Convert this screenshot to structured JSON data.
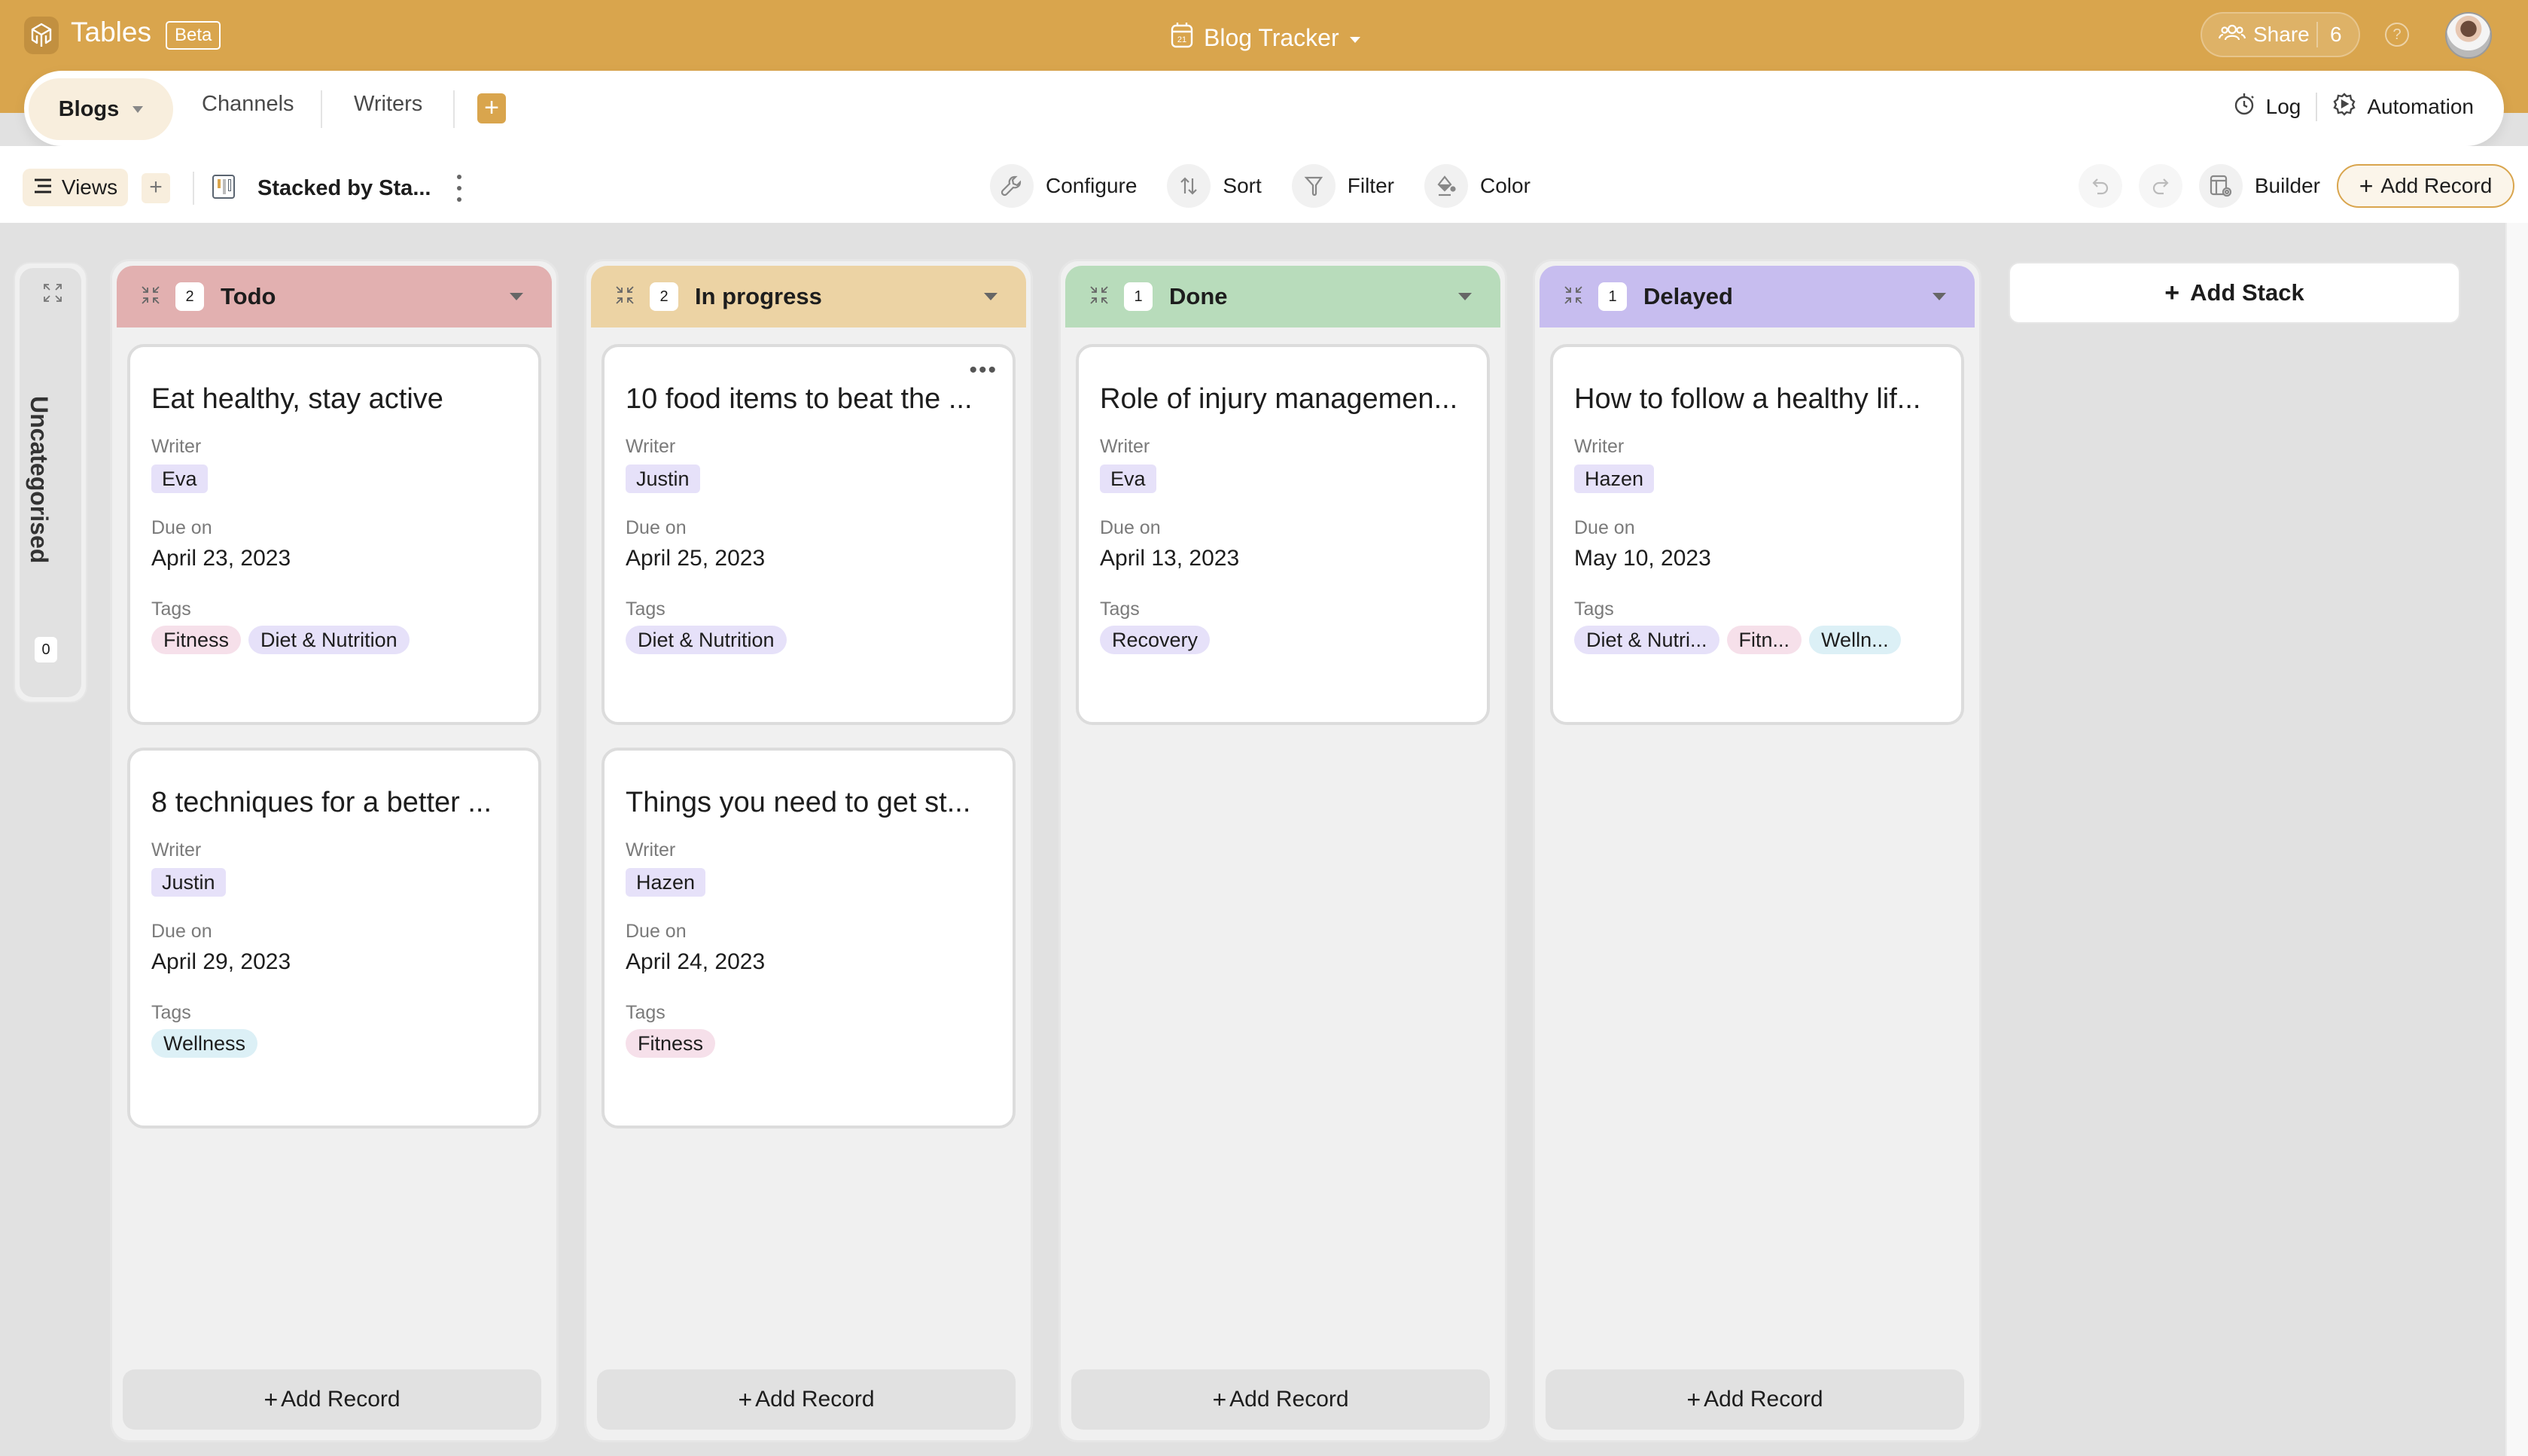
{
  "app": {
    "title": "Tables",
    "badge": "Beta",
    "doc_title": "Blog Tracker",
    "calendar_day": "21",
    "share_label": "Share",
    "share_count": "6",
    "help_label": "?"
  },
  "tabs": {
    "items": [
      {
        "label": "Blogs",
        "active": true
      },
      {
        "label": "Channels",
        "active": false
      },
      {
        "label": "Writers",
        "active": false
      }
    ],
    "add_label": "+",
    "log_label": "Log",
    "automation_label": "Automation"
  },
  "toolbar": {
    "views_label": "Views",
    "views_add": "+",
    "current_view": "Stacked by Sta...",
    "configure_label": "Configure",
    "sort_label": "Sort",
    "filter_label": "Filter",
    "color_label": "Color",
    "builder_label": "Builder",
    "add_record_label": "Add Record"
  },
  "colors": {
    "brand": "#d9a54d",
    "todo": "#e2b0b0",
    "in_progress": "#ecd3a4",
    "done": "#b8dcbb",
    "delayed": "#c7bdef",
    "tag_fitness": "#f6e0ea",
    "tag_diet": "#e6e1f9",
    "tag_wellness": "#dcf0f6",
    "tag_recovery": "#e6e1f9"
  },
  "board": {
    "uncategorised": {
      "label": "Uncategorised",
      "count": "0"
    },
    "field_labels": {
      "writer": "Writer",
      "due": "Due on",
      "tags": "Tags"
    },
    "add_record_label": "Add Record",
    "add_stack_label": "Add Stack",
    "stacks": [
      {
        "name": "Todo",
        "count": "2",
        "color_key": "todo",
        "cards": [
          {
            "title": "Eat healthy, stay active",
            "writer": "Eva",
            "due": "April 23, 2023",
            "tags": [
              {
                "label": "Fitness",
                "color_key": "tag_fitness"
              },
              {
                "label": "Diet & Nutrition",
                "color_key": "tag_diet"
              }
            ]
          },
          {
            "title": "8 techniques for a better ...",
            "writer": "Justin",
            "due": "April 29, 2023",
            "tags": [
              {
                "label": "Wellness",
                "color_key": "tag_wellness"
              }
            ]
          }
        ]
      },
      {
        "name": "In progress",
        "count": "2",
        "color_key": "in_progress",
        "cards": [
          {
            "title": "10 food items to beat the ...",
            "writer": "Justin",
            "due": "April 25, 2023",
            "show_more": true,
            "tags": [
              {
                "label": "Diet & Nutrition",
                "color_key": "tag_diet"
              }
            ]
          },
          {
            "title": "Things you need to get st...",
            "writer": "Hazen",
            "due": "April 24, 2023",
            "tags": [
              {
                "label": "Fitness",
                "color_key": "tag_fitness"
              }
            ]
          }
        ]
      },
      {
        "name": "Done",
        "count": "1",
        "color_key": "done",
        "cards": [
          {
            "title": "Role of injury managemen...",
            "writer": "Eva",
            "due": "April 13, 2023",
            "tags": [
              {
                "label": "Recovery",
                "color_key": "tag_recovery"
              }
            ]
          }
        ]
      },
      {
        "name": "Delayed",
        "count": "1",
        "color_key": "delayed",
        "cards": [
          {
            "title": "How to follow a healthy lif...",
            "writer": "Hazen",
            "due": "May 10, 2023",
            "tags": [
              {
                "label": "Diet & Nutri...",
                "color_key": "tag_diet"
              },
              {
                "label": "Fitn...",
                "color_key": "tag_fitness"
              },
              {
                "label": "Welln...",
                "color_key": "tag_wellness"
              }
            ]
          }
        ]
      }
    ]
  }
}
